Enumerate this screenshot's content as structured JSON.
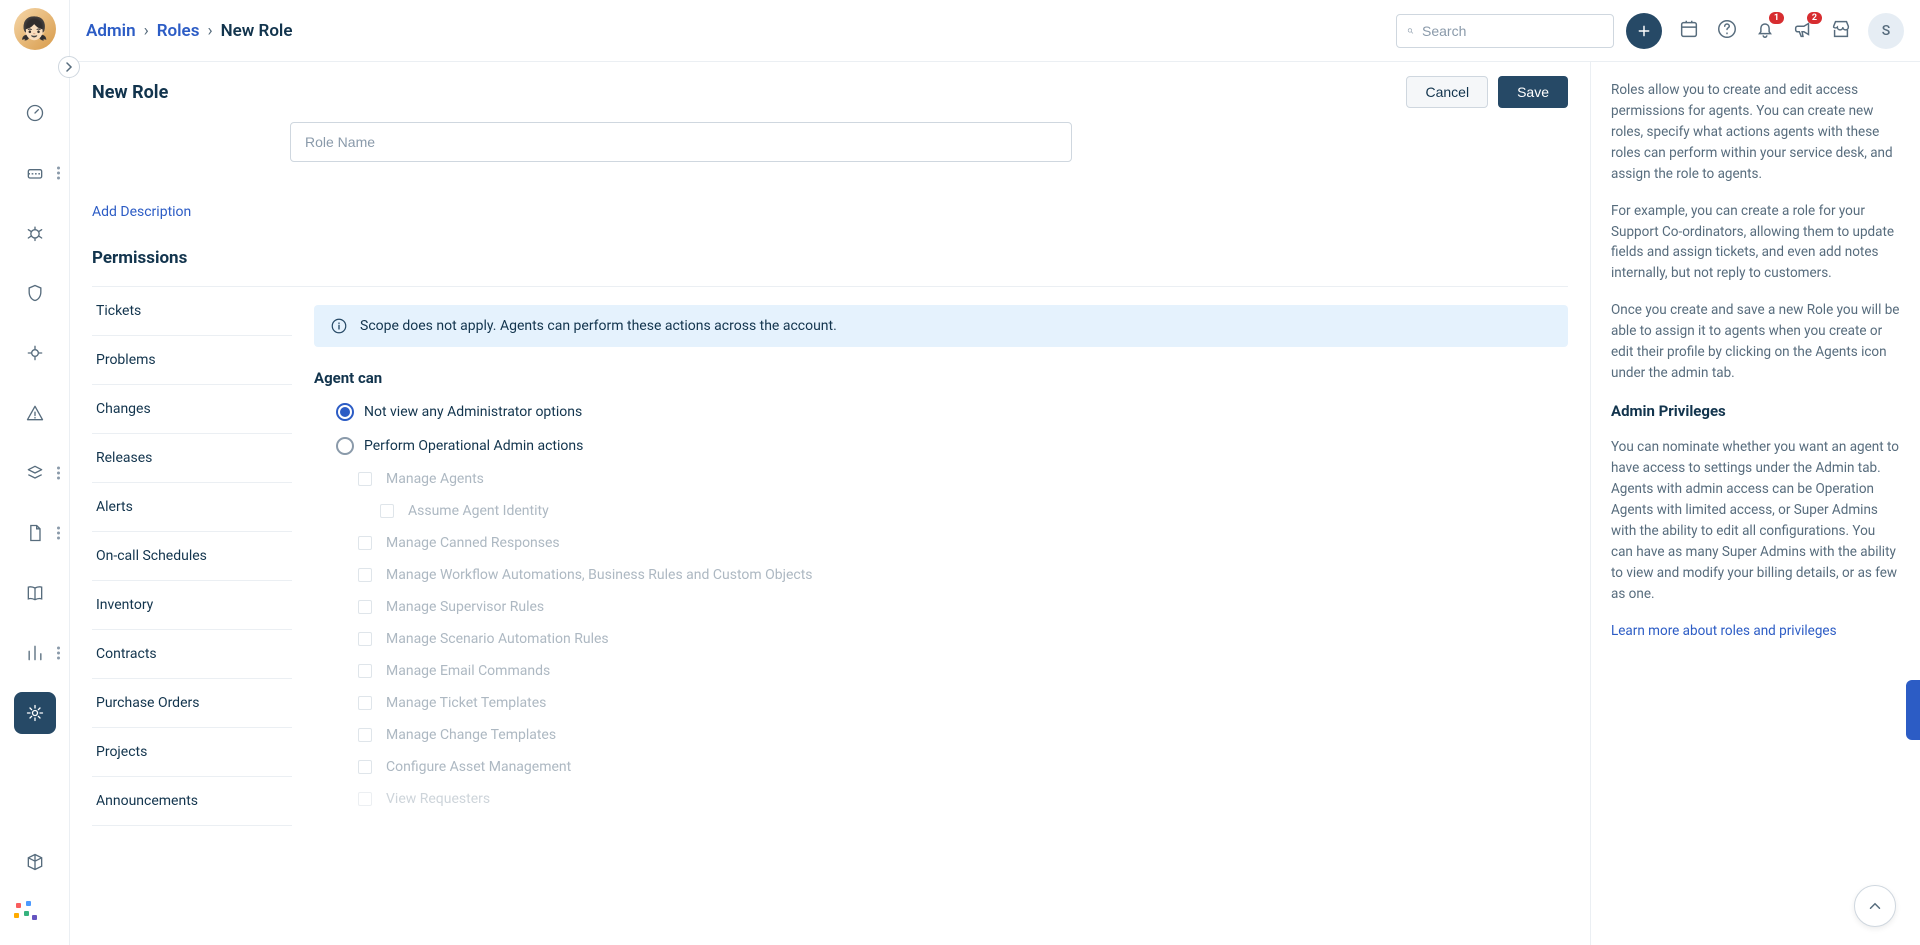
{
  "breadcrumb": {
    "admin": "Admin",
    "roles": "Roles",
    "current": "New Role"
  },
  "topbar": {
    "search_placeholder": "Search",
    "bell_badge": "1",
    "megaphone_badge": "2",
    "avatar_letter": "S"
  },
  "page": {
    "title": "New Role",
    "cancel": "Cancel",
    "save": "Save",
    "role_name_placeholder": "Role Name",
    "add_description": "Add Description"
  },
  "permissions": {
    "heading": "Permissions",
    "tabs": [
      "Tickets",
      "Problems",
      "Changes",
      "Releases",
      "Alerts",
      "On-call Schedules",
      "Inventory",
      "Contracts",
      "Purchase Orders",
      "Projects",
      "Announcements"
    ],
    "scope_msg": "Scope does not apply. Agents can perform these actions across the account.",
    "agent_can": "Agent can",
    "radio_not_view": "Not view any Administrator options",
    "radio_perform": "Perform Operational Admin actions",
    "checks": {
      "manage_agents": "Manage Agents",
      "assume_identity": "Assume Agent Identity",
      "manage_canned": "Manage Canned Responses",
      "manage_workflow": "Manage Workflow Automations, Business Rules and Custom Objects",
      "manage_supervisor": "Manage Supervisor Rules",
      "manage_scenario": "Manage Scenario Automation Rules",
      "manage_email": "Manage Email Commands",
      "manage_ticket_tpl": "Manage Ticket Templates",
      "manage_change_tpl": "Manage Change Templates",
      "configure_asset": "Configure Asset Management",
      "view_requesters": "View Requesters"
    }
  },
  "help": {
    "p1": "Roles allow you to create and edit access permissions for agents. You can create new roles, specify what actions agents with these roles can perform within your service desk, and assign the role to agents.",
    "p2": "For example, you can create a role for your Support Co-ordinators, allowing them to update fields and assign tickets, and even add notes internally, but not reply to customers.",
    "p3": "Once you create and save a new Role you will be able to assign it to agents when you create or edit their profile by clicking on the Agents icon under the admin tab.",
    "h": "Admin Privileges",
    "p4": "You can nominate whether you want an agent to have access to settings under the Admin tab. Agents with admin access can be Operation Agents with limited access, or Super Admins with the ability to edit all configurations. You can have as many Super Admins with the ability to view and modify your billing details, or as few as one.",
    "learn": "Learn more about roles and privileges"
  }
}
